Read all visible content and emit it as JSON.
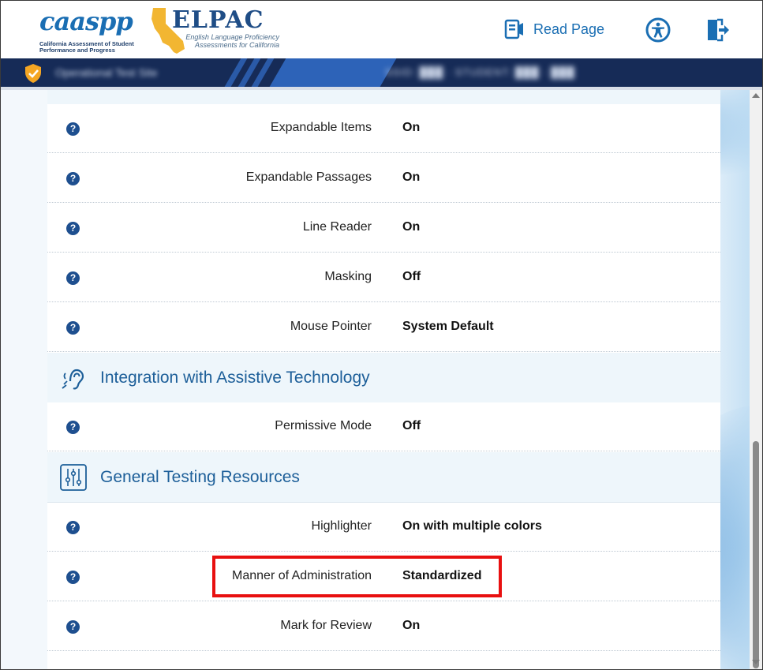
{
  "header": {
    "caaspp_logo_text": "caaspp",
    "caaspp_subtitle": "California Assessment of Student Performance and Progress",
    "elpac_logo_text": "ELPAC",
    "elpac_subtitle": "English Language Proficiency Assessments for California",
    "read_page_label": "Read Page"
  },
  "navbar": {
    "test_title_blurred": "Operational Test Site",
    "session_info_blurred": "SSID: ███ · STUDENT: ███ · ███"
  },
  "rows_top": [
    {
      "name": "Expandable Items",
      "value": "On"
    },
    {
      "name": "Expandable Passages",
      "value": "On"
    },
    {
      "name": "Line Reader",
      "value": "On"
    },
    {
      "name": "Masking",
      "value": "Off"
    },
    {
      "name": "Mouse Pointer",
      "value": "System Default"
    }
  ],
  "section_assistive": {
    "title": "Integration with Assistive Technology"
  },
  "rows_assistive": [
    {
      "name": "Permissive Mode",
      "value": "Off"
    }
  ],
  "section_general": {
    "title": "General Testing Resources"
  },
  "rows_general": [
    {
      "name": "Highlighter",
      "value": "On with multiple colors"
    },
    {
      "name": "Manner of Administration",
      "value": "Standardized"
    },
    {
      "name": "Mark for Review",
      "value": "On"
    }
  ],
  "help_glyph": "?",
  "colors": {
    "navbar": "#162b57",
    "accent": "#1d5f99",
    "help_icon": "#1e4f8f",
    "highlight_box": "#e81010",
    "shield": "#f5a623"
  }
}
